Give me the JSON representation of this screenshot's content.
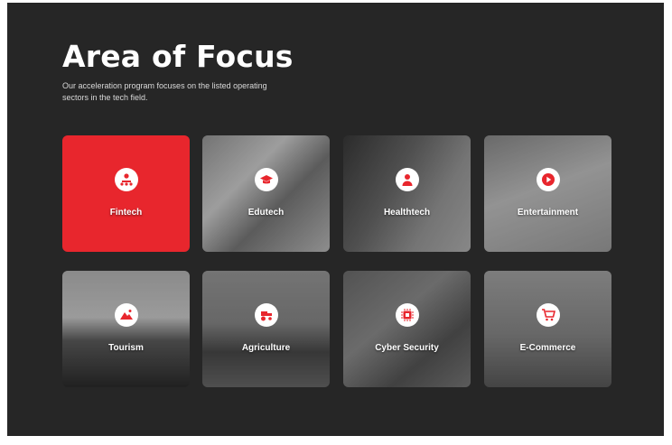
{
  "header": {
    "title": "Area of Focus",
    "subtitle": "Our acceleration program focuses on the listed operating sectors in the tech field."
  },
  "colors": {
    "accent": "#e8262d",
    "panel": "#262626"
  },
  "sectors": [
    {
      "label": "Fintech",
      "icon": "network-people-icon"
    },
    {
      "label": "Edutech",
      "icon": "graduation-icon"
    },
    {
      "label": "Healthtech",
      "icon": "doctor-icon"
    },
    {
      "label": "Entertainment",
      "icon": "play-icon"
    },
    {
      "label": "Tourism",
      "icon": "mountain-icon"
    },
    {
      "label": "Agriculture",
      "icon": "tractor-icon"
    },
    {
      "label": "Cyber Security",
      "icon": "chip-lock-icon"
    },
    {
      "label": "E-Commerce",
      "icon": "cart-icon"
    }
  ]
}
